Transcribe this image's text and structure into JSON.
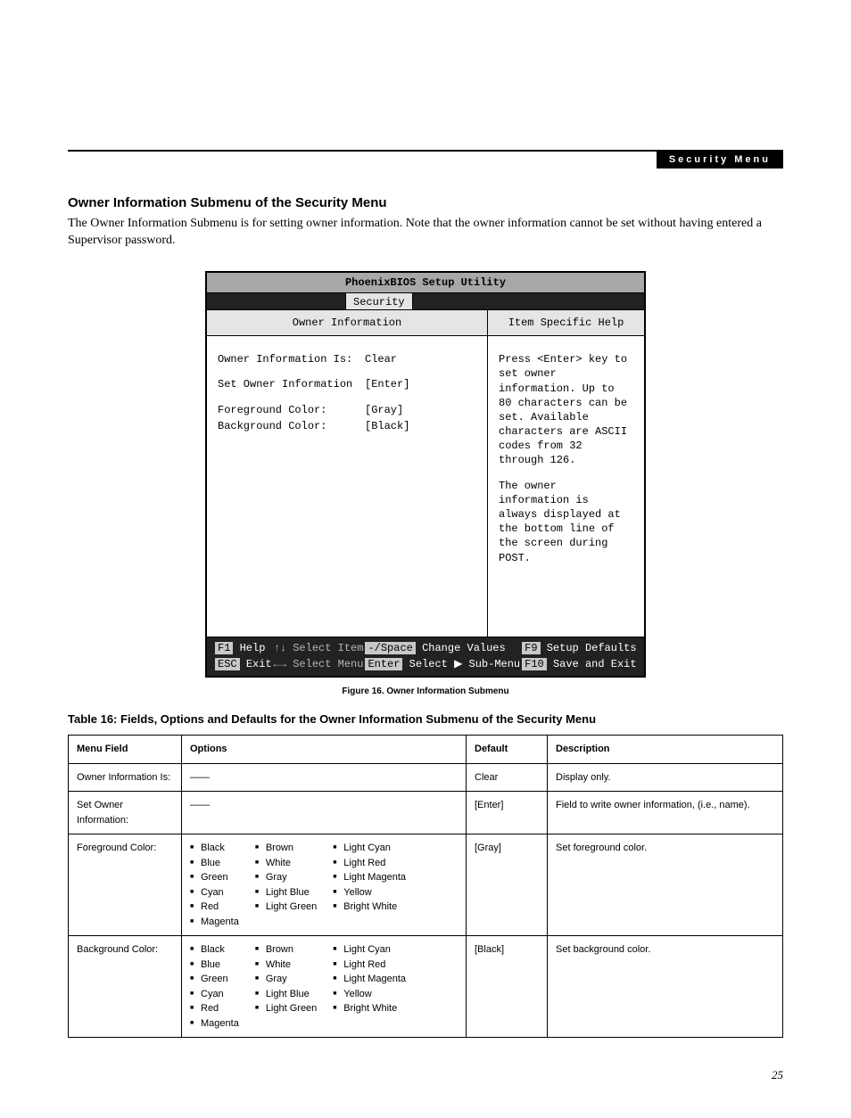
{
  "header": {
    "topbar_label": "Security Menu",
    "section_title": "Owner Information Submenu of the Security Menu",
    "intro": "The Owner Information Submenu is for setting owner information. Note that the owner information cannot be set without having entered a Supervisor password."
  },
  "bios": {
    "title": "PhoenixBIOS Setup Utility",
    "menubar_active": "Security",
    "left_panel_title": "Owner Information",
    "right_panel_title": "Item Specific Help",
    "rows": [
      {
        "label": "Owner Information Is:",
        "value": "Clear",
        "tight": false
      },
      {
        "label": "Set Owner Information",
        "value": "[Enter]",
        "tight": false
      },
      {
        "label": "Foreground Color:",
        "value": "[Gray]",
        "tight": true
      },
      {
        "label": "Background Color:",
        "value": "[Black]",
        "tight": false
      }
    ],
    "help_para1": "Press <Enter> key to set owner information. Up to 80 characters can be set. Available characters are ASCII codes from 32 through 126.",
    "help_para2": "The owner information is always displayed at the bottom line of the screen during POST.",
    "footer": {
      "r1c1k": "F1",
      "r1c1v": "Help",
      "r1c2k": "↑↓",
      "r1c2v": "Select Item",
      "r1c3k": "-/Space",
      "r1c3v": "Change Values",
      "r1c4k": "F9",
      "r1c4v": "Setup Defaults",
      "r2c1k": "ESC",
      "r2c1v": "Exit",
      "r2c2k": "←→",
      "r2c2v": "Select Menu",
      "r2c3k": "Enter",
      "r2c3v": "Select ▶ Sub-Menu",
      "r2c4k": "F10",
      "r2c4v": "Save and Exit"
    }
  },
  "caption": "Figure 16.   Owner Information Submenu",
  "table": {
    "title": "Table 16: Fields, Options and Defaults for the Owner Information Submenu of the Security Menu",
    "headers": [
      "Menu Field",
      "Options",
      "Default",
      "Description"
    ],
    "rows": [
      {
        "menu": "Owner Information Is:",
        "options_dash": "——",
        "default": "Clear",
        "desc": "Display only."
      },
      {
        "menu": "Set Owner Information:",
        "options_dash": "——",
        "default": "[Enter]",
        "desc": "Field to write owner information, (i.e., name)."
      },
      {
        "menu": "Foreground Color:",
        "option_cols": [
          [
            "Black",
            "Blue",
            "Green",
            "Cyan",
            "Red",
            "Magenta"
          ],
          [
            "Brown",
            "White",
            "Gray",
            "Light Blue",
            "Light Green"
          ],
          [
            "Light Cyan",
            "Light Red",
            "Light Magenta",
            "Yellow",
            "Bright White"
          ]
        ],
        "default": "[Gray]",
        "desc": "Set foreground color."
      },
      {
        "menu": "Background Color:",
        "option_cols": [
          [
            "Black",
            "Blue",
            "Green",
            "Cyan",
            "Red",
            "Magenta"
          ],
          [
            "Brown",
            "White",
            "Gray",
            "Light Blue",
            "Light Green"
          ],
          [
            "Light Cyan",
            "Light Red",
            "Light Magenta",
            "Yellow",
            "Bright White"
          ]
        ],
        "default": "[Black]",
        "desc": "Set background color."
      }
    ]
  },
  "page_number": "25"
}
